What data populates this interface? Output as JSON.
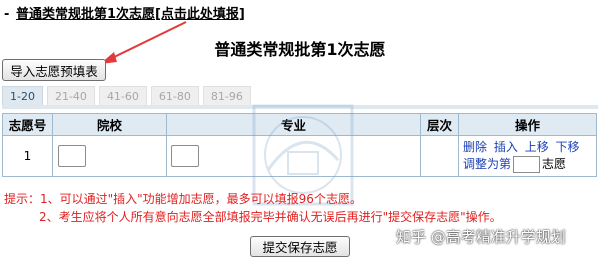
{
  "header": {
    "prefix": "-",
    "link_text": "普通类常规批第1次志愿[点击此处填报]"
  },
  "title": "普通类常规批第1次志愿",
  "import_button": "导入志愿预填表",
  "tabs": [
    "1-20",
    "21-40",
    "41-60",
    "61-80",
    "81-96"
  ],
  "table": {
    "headers": {
      "number": "志愿号",
      "school": "院校",
      "major": "专业",
      "level": "层次",
      "actions": "操作"
    },
    "row": {
      "number": "1",
      "actions": {
        "delete": "删除",
        "insert": "插入",
        "move_up": "上移",
        "move_down": "下移",
        "adjust_prefix": "调整为第",
        "adjust_suffix": "志愿"
      }
    }
  },
  "tips": {
    "line1": "提示：1、可以通过\"插入\"功能增加志愿，最多可以填报96个志愿。",
    "line2": "2、考生应将个人所有意向志愿全部填报完毕并确认无误后再进行\"提交保存志愿\"操作。"
  },
  "submit_button": "提交保存志愿",
  "watermark_text": "知乎 @高考精准升学规划",
  "colors": {
    "tab_active_bg": "#dfe8ef",
    "header_bg": "#dfeaf3",
    "border": "#9fb9ce",
    "tip_red": "#e02020",
    "link_blue": "#1a3fb3",
    "arrow_red": "#e23a3a"
  }
}
